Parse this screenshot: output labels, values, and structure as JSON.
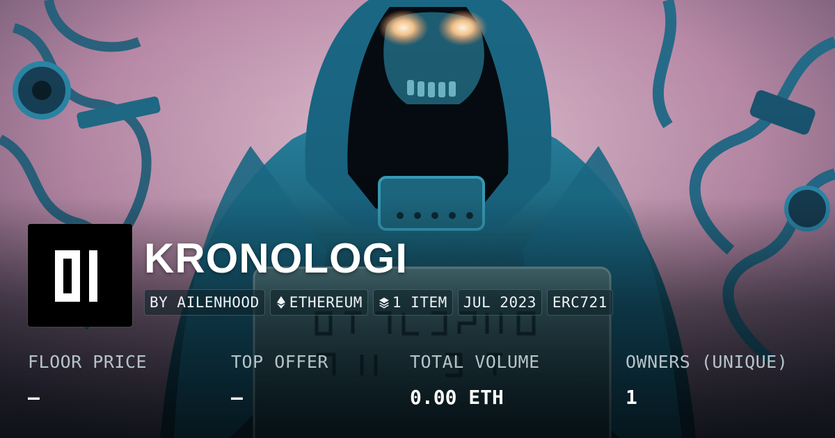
{
  "collection": {
    "name": "KRONOLOGI",
    "logo_text": "0I",
    "background_art": "hooded-cyber-skull-illustration"
  },
  "tags": [
    {
      "icon": "",
      "label": "BY AILENHOOD"
    },
    {
      "icon": "ethereum-icon",
      "label": "ETHEREUM"
    },
    {
      "icon": "layers-icon",
      "label": "1 ITEM"
    },
    {
      "icon": "",
      "label": "JUL 2023"
    },
    {
      "icon": "",
      "label": "ERC721"
    }
  ],
  "stats": [
    {
      "label": "FLOOR PRICE",
      "value": "–"
    },
    {
      "label": "TOP OFFER",
      "value": "–"
    },
    {
      "label": "TOTAL VOLUME",
      "value": "0.00 ETH"
    },
    {
      "label": "OWNERS (UNIQUE)",
      "value": "1"
    }
  ],
  "colors": {
    "accent_teal": "#1c6f86",
    "pink_wash": "#d9a8c4",
    "text_muted": "#b6c3c8"
  }
}
